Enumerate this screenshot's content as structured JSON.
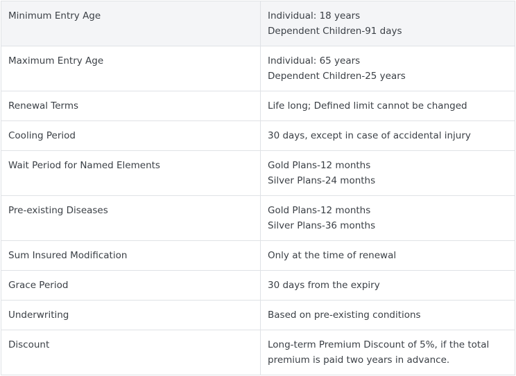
{
  "rows": [
    {
      "label": "Minimum Entry Age",
      "value": [
        "Individual: 18 years",
        "Dependent Children-91 days"
      ]
    },
    {
      "label": "Maximum Entry Age",
      "value": [
        "Individual: 65 years",
        "Dependent Children-25 years"
      ]
    },
    {
      "label": "Renewal Terms",
      "value": [
        "Life long; Defined limit cannot be changed"
      ]
    },
    {
      "label": "Cooling Period",
      "value": [
        "30 days, except in case of accidental injury"
      ]
    },
    {
      "label": "Wait Period for Named Elements",
      "value": [
        "Gold Plans-12  months",
        "Silver Plans-24 months"
      ]
    },
    {
      "label": "Pre-existing Diseases",
      "value": [
        "Gold Plans-12  months",
        "Silver Plans-36 months"
      ]
    },
    {
      "label": "Sum Insured Modification",
      "value": [
        "Only at the time of renewal"
      ]
    },
    {
      "label": "Grace Period",
      "value": [
        "30 days from the expiry"
      ]
    },
    {
      "label": "Underwriting",
      "value": [
        "Based on pre-existing conditions"
      ]
    },
    {
      "label": "Discount",
      "value": [
        "Long-term Premium Discount of 5%, if the total",
        "premium is paid two years in advance."
      ]
    }
  ]
}
